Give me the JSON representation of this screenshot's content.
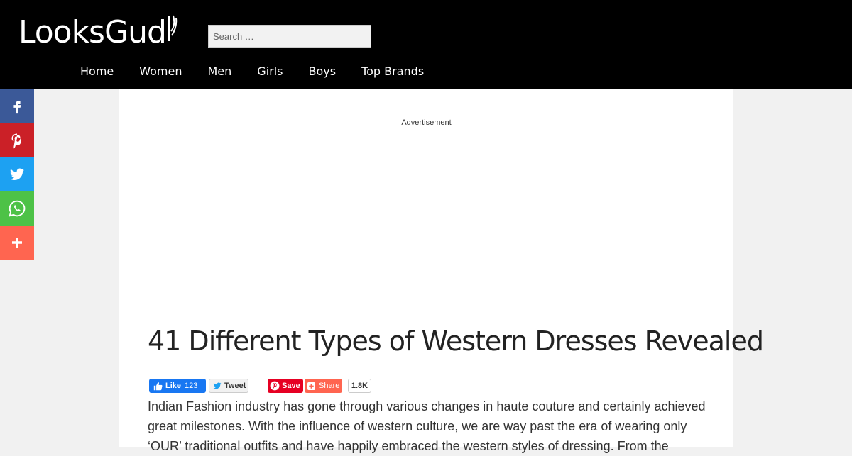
{
  "site": {
    "logo_text": "LooksGud"
  },
  "search": {
    "placeholder": "Search …"
  },
  "nav": {
    "items": [
      {
        "label": "Home"
      },
      {
        "label": "Women"
      },
      {
        "label": "Men"
      },
      {
        "label": "Girls"
      },
      {
        "label": "Boys"
      },
      {
        "label": "Top Brands"
      }
    ]
  },
  "share_bar": {
    "buttons": [
      {
        "icon": "facebook-icon",
        "color": "#3b5998"
      },
      {
        "icon": "pinterest-icon",
        "color": "#cb2027"
      },
      {
        "icon": "twitter-icon",
        "color": "#1da1f2"
      },
      {
        "icon": "whatsapp-icon",
        "color": "#4dc247"
      },
      {
        "icon": "plus-icon",
        "color": "#ff6550"
      }
    ]
  },
  "content": {
    "ad_label": "Advertisement",
    "title": "41 Different Types of Western Dresses Revealed",
    "social": {
      "fb_like": "Like",
      "fb_count": "123",
      "tweet": "Tweet",
      "pin_save": "Save",
      "share": "Share",
      "share_count": "1.8K"
    },
    "intro": "Indian Fashion industry has gone through various changes in haute couture and certainly achieved great milestones. With the influence of western culture, we are way past the era of wearing only ‘OUR’ traditional outfits and have happily embraced the western styles of dressing. From the"
  }
}
